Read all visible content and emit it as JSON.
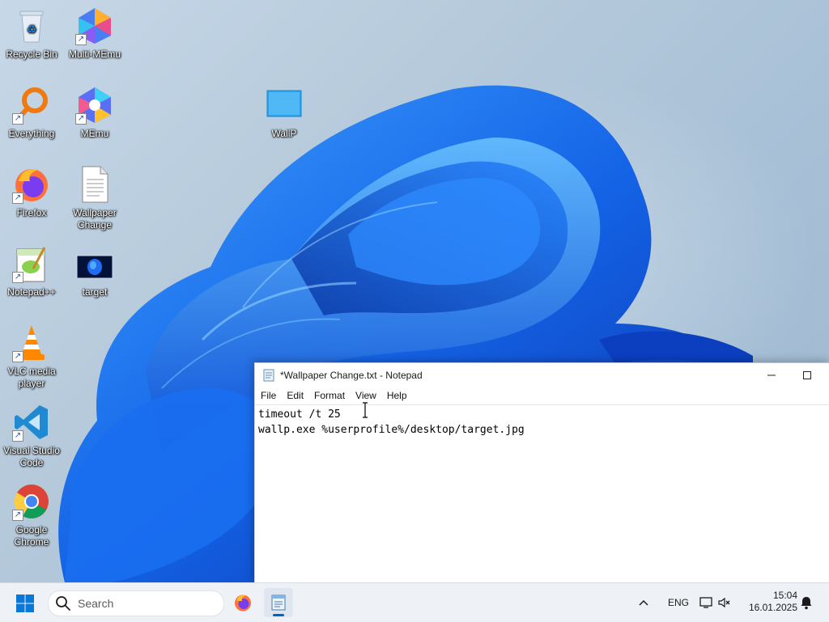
{
  "desktop": {
    "icons": [
      {
        "id": "recycle-bin",
        "label": "Recycle Bin",
        "icon": "recycle-bin-icon"
      },
      {
        "id": "multi-memu",
        "label": "Multi-MEmu",
        "icon": "multi-memu-icon"
      },
      {
        "id": "everything",
        "label": "Everything",
        "icon": "everything-search-icon"
      },
      {
        "id": "memu",
        "label": "MEmu",
        "icon": "memu-icon"
      },
      {
        "id": "wallp",
        "label": "WallP",
        "icon": "wallp-folder-icon"
      },
      {
        "id": "firefox",
        "label": "Firefox",
        "icon": "firefox-icon"
      },
      {
        "id": "wallpaper-change",
        "label": "Wallpaper Change",
        "icon": "text-file-icon"
      },
      {
        "id": "notepadpp",
        "label": "Notepad++",
        "icon": "notepadpp-icon"
      },
      {
        "id": "target",
        "label": "target",
        "icon": "image-file-icon"
      },
      {
        "id": "vlc",
        "label": "VLC media player",
        "icon": "vlc-icon"
      },
      {
        "id": "vscode",
        "label": "Visual Studio Code",
        "icon": "vscode-icon"
      },
      {
        "id": "chrome",
        "label": "Google Chrome",
        "icon": "chrome-icon"
      }
    ]
  },
  "notepad": {
    "title": "*Wallpaper Change.txt - Notepad",
    "menu": [
      "File",
      "Edit",
      "Format",
      "View",
      "Help"
    ],
    "content": "timeout /t 25\nwallp.exe %userprofile%/desktop/target.jpg"
  },
  "taskbar": {
    "search_placeholder": "Search",
    "language": "ENG",
    "time": "15:04",
    "date": "16.01.2025",
    "accent": "#0067c0"
  }
}
